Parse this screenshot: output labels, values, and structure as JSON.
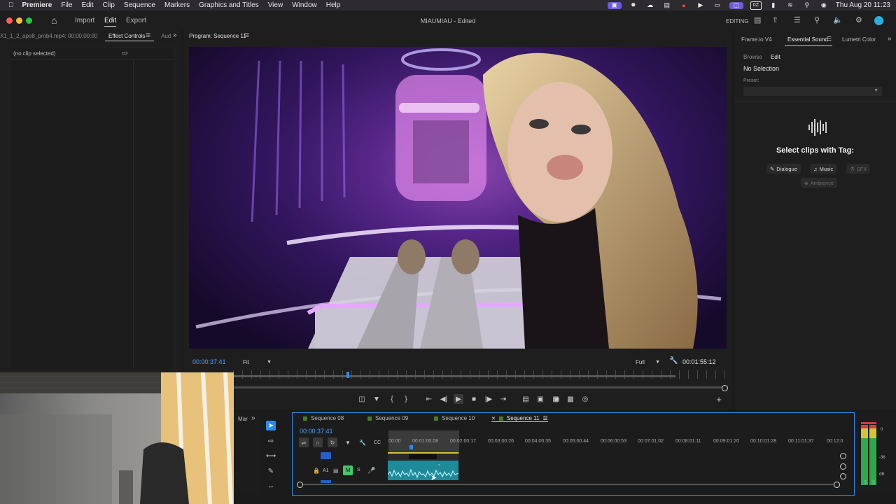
{
  "menubar": {
    "app": "Premiere",
    "items": [
      "File",
      "Edit",
      "Clip",
      "Sequence",
      "Markers",
      "Graphics and Titles",
      "View",
      "Window",
      "Help"
    ],
    "clock": "Thu Aug 20  11:23",
    "badge": "0Z"
  },
  "header": {
    "nav": [
      "Import",
      "Edit",
      "Export"
    ],
    "title": "MIAUMIAU - Edited",
    "workspace": "EDITING"
  },
  "left_panel": {
    "source_label": "X1_1_2_apo8_prob4.mp4: 00:00:00:00",
    "tab_effect_controls": "Effect Controls",
    "tab_audio": "Aud",
    "no_clip": "(no clip selected)"
  },
  "program": {
    "title": "Program: Sequence 11",
    "current_time": "00:00:37:41",
    "fit": "Fit",
    "quality": "Full",
    "duration": "00:01:55:12"
  },
  "right_panel": {
    "tabs": [
      "Frame.io V4",
      "Essential Sound",
      "Lumetri Color"
    ],
    "subtabs": [
      "Browse",
      "Edit"
    ],
    "no_selection": "No Selection",
    "preset_label": "Preset:",
    "heading": "Select clips with Tag:",
    "tags": [
      "Dialogue",
      "Music",
      "SFX",
      "Ambience"
    ]
  },
  "timeline": {
    "panel_label": "Mar",
    "tabs": [
      "Sequence 08",
      "Sequence 09",
      "Sequence 10",
      "Sequence 11"
    ],
    "timecode": "00:00:37:41",
    "ruler": [
      "00:00",
      "00:01:00:08",
      "00:02:00:17",
      "00:03:00:26",
      "00:04:00:35",
      "00:05:00:44",
      "00:06:00:53",
      "00:07:01:02",
      "00:08:01:11",
      "00:09:01:20",
      "00:10:01:28",
      "00:11:01:37",
      "00:12:0"
    ],
    "track_a1": "A1",
    "track_m": "M",
    "track_s": "S"
  },
  "meter": {
    "labels": [
      "0",
      "-36",
      "dB"
    ],
    "solo": [
      "S",
      "S"
    ]
  },
  "colors": {
    "accent": "#2d8ceb",
    "timecode": "#4fa3ff",
    "clip": "#1e8a9a"
  }
}
